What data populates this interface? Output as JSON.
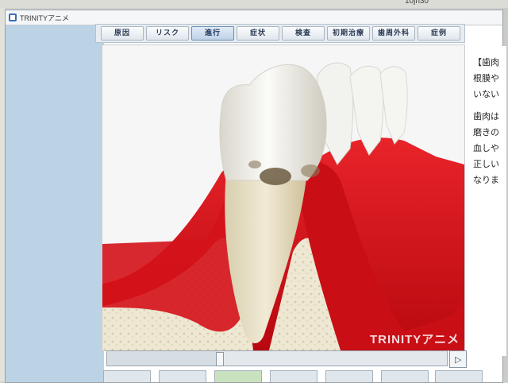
{
  "screen": {
    "clock_fragment": "10jn30"
  },
  "window": {
    "title": "TRINITYアニメ"
  },
  "tabs": [
    {
      "label": "原因",
      "active": false
    },
    {
      "label": "リスク",
      "active": false
    },
    {
      "label": "進行",
      "active": true
    },
    {
      "label": "症状",
      "active": false
    },
    {
      "label": "検査",
      "active": false
    },
    {
      "label": "初期治療",
      "active": false
    },
    {
      "label": "歯周外科",
      "active": false
    },
    {
      "label": "症例",
      "active": false
    }
  ],
  "animation": {
    "watermark": "TRINITYアニメ"
  },
  "player": {
    "progress": 0.33,
    "play_icon": "▷"
  },
  "side_text": {
    "lines": [
      "【歯肉",
      "根膜や",
      "いない",
      "",
      "歯肉は",
      "磨きの",
      "血しや",
      "正しい",
      "なりま"
    ]
  },
  "colors": {
    "gum": "#d9181f",
    "bone": "#eee7d2",
    "tab_active": "#bdd1e6",
    "panel_blue": "#bcd3e6"
  }
}
